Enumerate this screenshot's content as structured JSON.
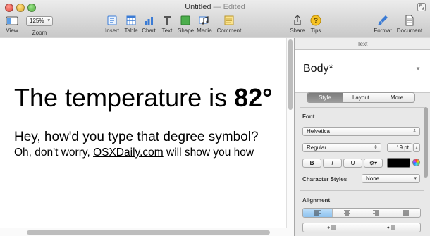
{
  "window": {
    "title": "Untitled",
    "separator": " — ",
    "status": "Edited"
  },
  "toolbar": {
    "view": "View",
    "zoom_value": "125%",
    "zoom_label": "Zoom",
    "insert": "Insert",
    "table": "Table",
    "chart": "Chart",
    "text": "Text",
    "shape": "Shape",
    "media": "Media",
    "comment": "Comment",
    "share": "Share",
    "tips": "Tips",
    "format": "Format",
    "document": "Document"
  },
  "document": {
    "heading_text": "The temperature is ",
    "heading_bold": "82°",
    "line1": "Hey, how'd you type that degree symbol?",
    "line2_prefix": "Oh, don't worry, ",
    "line2_link": "OSXDaily.com",
    "line2_suffix": " will show you how"
  },
  "inspector": {
    "header": "Text",
    "paragraph_style": "Body*",
    "tabs": [
      "Style",
      "Layout",
      "More"
    ],
    "active_tab": "Style",
    "font_label": "Font",
    "font_family": "Helvetica",
    "font_weight": "Regular",
    "font_size": "19 pt",
    "bold": "B",
    "italic": "I",
    "underline": "U",
    "text_color": "#000000",
    "char_styles_label": "Character Styles",
    "char_styles_value": "None",
    "alignment_label": "Alignment"
  },
  "colors": {
    "accent_active_align": "#8ec2ef",
    "active_tab_bg": "#8a8a8a"
  }
}
